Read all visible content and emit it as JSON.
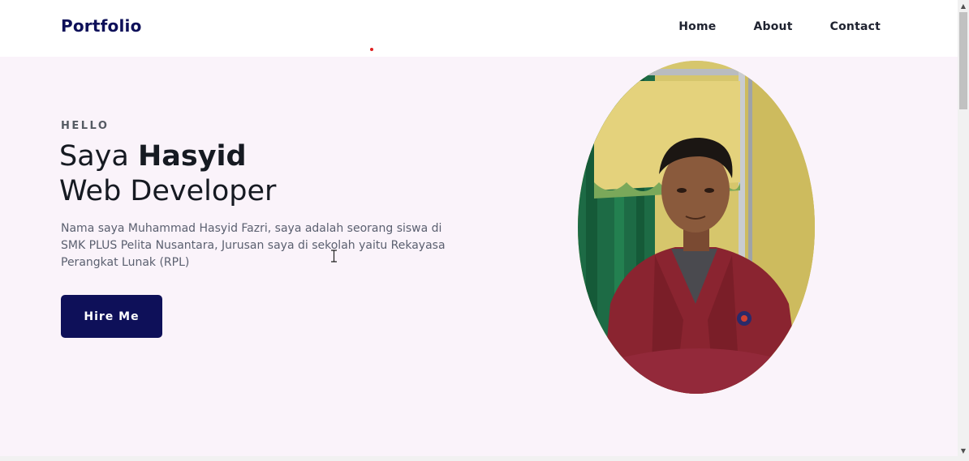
{
  "nav": {
    "logo": "Portfolio",
    "links": [
      "Home",
      "About",
      "Contact"
    ]
  },
  "hero": {
    "greeting": "HELLO",
    "headline_prefix": "Saya ",
    "headline_name": "Hasyid",
    "headline_role": "Web Developer",
    "bio": "Nama saya Muhammad Hasyid Fazri, saya adalah seorang siswa di SMK PLUS Pelita Nusantara, Jurusan saya di sekolah yaitu Rekayasa Perangkat Lunak (RPL)",
    "cta_label": "Hire Me"
  },
  "colors": {
    "brand": "#0e1059",
    "hero_bg": "#faf3fa",
    "jacket": "#8a2430"
  },
  "icons": {
    "scroll_up": "triangle-up",
    "scroll_down": "triangle-down"
  }
}
